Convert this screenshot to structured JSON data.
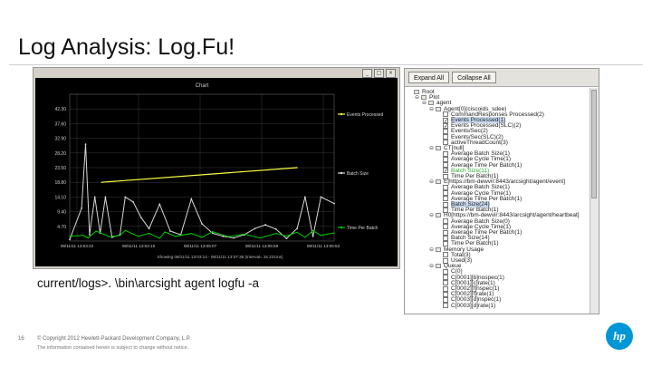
{
  "slide": {
    "title": "Log Analysis: Log.Fu!",
    "page_number": "16",
    "copyright": "© Copyright 2012 Hewlett-Packard Development Company, L.P.",
    "note": "The information contained herein is subject to change without notice.",
    "logo_text": "hp"
  },
  "chart_window": {
    "title": "Chart",
    "buttons": [
      "_",
      "□",
      "×"
    ]
  },
  "chart_data": {
    "type": "line",
    "title": "Chart",
    "y_ticks": [
      "42.30",
      "37.60",
      "32.90",
      "28.20",
      "23.50",
      "18.80",
      "14.10",
      "9.40",
      "4.70"
    ],
    "x_ticks": [
      "08/11/11 13:03:22",
      "08/11/11 13:04:15",
      "08/11/11 13:05:07",
      "08/11/11 13:05:59",
      "08/11/11 13:06:52"
    ],
    "status": "Showing 08/11/11 13:03:14 - 08/11/11 13:07:36 (Interval= 3s 221ms)",
    "ylim": [
      0,
      47
    ],
    "series": [
      {
        "name": "Events Processed",
        "color": "#ffff44",
        "x": [
          0.12,
          0.86
        ],
        "y": [
          18.8,
          23.5
        ]
      },
      {
        "name": "Batch Size",
        "color": "#d8d8d8",
        "x": [
          0.0,
          0.045,
          0.06,
          0.075,
          0.095,
          0.115,
          0.135,
          0.16,
          0.19,
          0.21,
          0.24,
          0.27,
          0.3,
          0.34,
          0.38,
          0.42,
          0.46,
          0.5,
          0.54,
          0.58,
          0.62,
          0.66,
          0.7,
          0.74,
          0.78,
          0.82,
          0.86,
          0.89,
          0.92,
          0.95,
          1.0
        ],
        "y": [
          0.5,
          10.5,
          31.0,
          2.0,
          14.1,
          2.5,
          14.1,
          1.2,
          2.0,
          14.1,
          12.5,
          7.5,
          4.0,
          11.8,
          3.2,
          2.0,
          13.5,
          5.5,
          2.5,
          1.5,
          1.0,
          2.0,
          4.0,
          5.2,
          3.8,
          0.8,
          4.0,
          14.1,
          1.5,
          14.1,
          12.0
        ]
      },
      {
        "name": "Time Per Batch",
        "color": "#00cc00",
        "x": [
          0.0,
          0.05,
          0.07,
          0.1,
          0.15,
          0.19,
          0.21,
          0.26,
          0.3,
          0.34,
          0.36,
          0.4,
          0.46,
          0.5,
          0.54,
          0.6,
          0.66,
          0.72,
          0.78,
          0.82,
          0.86,
          0.89,
          0.92,
          0.95,
          1.0
        ],
        "y": [
          1.5,
          1.8,
          1.0,
          3.2,
          1.4,
          1.8,
          3.4,
          1.5,
          2.5,
          0.9,
          2.9,
          1.5,
          2.4,
          1.2,
          3.0,
          1.4,
          2.2,
          1.0,
          2.4,
          1.6,
          2.8,
          1.2,
          3.3,
          1.8,
          2.6
        ]
      }
    ]
  },
  "command": "current/logs>. \\bin\\arcsight agent logfu -a",
  "tree": {
    "toolbar": [
      "Expand All",
      "Collapse All"
    ],
    "rows": [
      {
        "indent": 0,
        "kind": "folder",
        "expander": "",
        "label": "Root",
        "checked": false,
        "highlight": false,
        "green": false
      },
      {
        "indent": 1,
        "kind": "folder",
        "expander": "⊖",
        "label": "Plot",
        "checked": false,
        "highlight": false,
        "green": false
      },
      {
        "indent": 2,
        "kind": "folder",
        "expander": "⊖",
        "label": "agent",
        "checked": false,
        "highlight": false,
        "green": false
      },
      {
        "indent": 3,
        "kind": "folder",
        "expander": "⊖",
        "label": "Agent[0](ciscoids_sdee)",
        "checked": false,
        "highlight": false,
        "green": false
      },
      {
        "indent": 4,
        "kind": "check",
        "expander": "",
        "label": "CommandResponses Processed(2)",
        "checked": false,
        "highlight": false,
        "green": false
      },
      {
        "indent": 4,
        "kind": "check",
        "expander": "",
        "label": "Events Processed(1)",
        "checked": true,
        "highlight": true,
        "green": false
      },
      {
        "indent": 4,
        "kind": "check",
        "expander": "",
        "label": "Events Processed(SLC)(2)",
        "checked": true,
        "highlight": false,
        "green": false
      },
      {
        "indent": 4,
        "kind": "check",
        "expander": "",
        "label": "Events/Sec(2)",
        "checked": false,
        "highlight": false,
        "green": false
      },
      {
        "indent": 4,
        "kind": "check",
        "expander": "",
        "label": "Events/Sec(SLC)(2)",
        "checked": false,
        "highlight": false,
        "green": false
      },
      {
        "indent": 4,
        "kind": "check",
        "expander": "",
        "label": "activeThreadCount(3)",
        "checked": false,
        "highlight": false,
        "green": false
      },
      {
        "indent": 3,
        "kind": "folder",
        "expander": "⊖",
        "label": "CT[null]",
        "checked": false,
        "highlight": false,
        "green": false
      },
      {
        "indent": 4,
        "kind": "check",
        "expander": "",
        "label": "Average Batch Size(1)",
        "checked": false,
        "highlight": false,
        "green": false
      },
      {
        "indent": 4,
        "kind": "check",
        "expander": "",
        "label": "Average Cycle Time(1)",
        "checked": false,
        "highlight": false,
        "green": false
      },
      {
        "indent": 4,
        "kind": "check",
        "expander": "",
        "label": "Average Time Per Batch(1)",
        "checked": false,
        "highlight": false,
        "green": false
      },
      {
        "indent": 4,
        "kind": "check",
        "expander": "",
        "label": "Batch Size(11)",
        "checked": true,
        "highlight": false,
        "green": true
      },
      {
        "indent": 4,
        "kind": "check",
        "expander": "",
        "label": "Time Per Batch(1)",
        "checked": false,
        "highlight": false,
        "green": false
      },
      {
        "indent": 3,
        "kind": "folder",
        "expander": "⊖",
        "label": "E[https://bm-dewvir:8443/arcsight/agent/event]",
        "checked": false,
        "highlight": false,
        "green": false
      },
      {
        "indent": 4,
        "kind": "check",
        "expander": "",
        "label": "Average Batch Size(1)",
        "checked": false,
        "highlight": false,
        "green": false
      },
      {
        "indent": 4,
        "kind": "check",
        "expander": "",
        "label": "Average Cycle Time(1)",
        "checked": false,
        "highlight": false,
        "green": false
      },
      {
        "indent": 4,
        "kind": "check",
        "expander": "",
        "label": "Average Time Per Batch(1)",
        "checked": false,
        "highlight": false,
        "green": false
      },
      {
        "indent": 4,
        "kind": "check",
        "expander": "",
        "label": "Batch Size(24)",
        "checked": false,
        "highlight": true,
        "green": false
      },
      {
        "indent": 4,
        "kind": "check",
        "expander": "",
        "label": "Time Per Batch(1)",
        "checked": false,
        "highlight": false,
        "green": false
      },
      {
        "indent": 3,
        "kind": "folder",
        "expander": "⊖",
        "label": "H0[https://bm-dewvir:8443/arcsight/agent/heartbeat]",
        "checked": false,
        "highlight": false,
        "green": false
      },
      {
        "indent": 4,
        "kind": "check",
        "expander": "",
        "label": "Average Batch Size(0)",
        "checked": false,
        "highlight": false,
        "green": false
      },
      {
        "indent": 4,
        "kind": "check",
        "expander": "",
        "label": "Average Cycle Time(1)",
        "checked": false,
        "highlight": false,
        "green": false
      },
      {
        "indent": 4,
        "kind": "check",
        "expander": "",
        "label": "Average Time Per Batch(1)",
        "checked": false,
        "highlight": false,
        "green": false
      },
      {
        "indent": 4,
        "kind": "check",
        "expander": "",
        "label": "Batch Size(14)",
        "checked": false,
        "highlight": false,
        "green": false
      },
      {
        "indent": 4,
        "kind": "check",
        "expander": "",
        "label": "Time Per Batch(1)",
        "checked": false,
        "highlight": false,
        "green": false
      },
      {
        "indent": 3,
        "kind": "folder",
        "expander": "⊖",
        "label": "Memory Usage",
        "checked": false,
        "highlight": false,
        "green": false
      },
      {
        "indent": 4,
        "kind": "check",
        "expander": "",
        "label": "Total(3)",
        "checked": false,
        "highlight": false,
        "green": false
      },
      {
        "indent": 4,
        "kind": "check",
        "expander": "",
        "label": "Used(3)",
        "checked": false,
        "highlight": false,
        "green": false
      },
      {
        "indent": 3,
        "kind": "folder",
        "expander": "⊖",
        "label": "Queue",
        "checked": false,
        "highlight": false,
        "green": false
      },
      {
        "indent": 4,
        "kind": "check",
        "expander": "",
        "label": "C(0)",
        "checked": false,
        "highlight": false,
        "green": false
      },
      {
        "indent": 4,
        "kind": "check",
        "expander": "",
        "label": "C[0001][b]nospec(1)",
        "checked": false,
        "highlight": false,
        "green": false
      },
      {
        "indent": 4,
        "kind": "check",
        "expander": "",
        "label": "C[0001][c]rate(1)",
        "checked": false,
        "highlight": false,
        "green": false
      },
      {
        "indent": 4,
        "kind": "check",
        "expander": "",
        "label": "C[0002][f]nspec(1)",
        "checked": false,
        "highlight": false,
        "green": false
      },
      {
        "indent": 4,
        "kind": "check",
        "expander": "",
        "label": "C[0002][f]rate(1)",
        "checked": false,
        "highlight": false,
        "green": false
      },
      {
        "indent": 4,
        "kind": "check",
        "expander": "",
        "label": "C[0003][d]nspec(1)",
        "checked": false,
        "highlight": false,
        "green": false
      },
      {
        "indent": 4,
        "kind": "check",
        "expander": "",
        "label": "C[0003][d]rate(1)",
        "checked": false,
        "highlight": false,
        "green": false
      }
    ]
  }
}
